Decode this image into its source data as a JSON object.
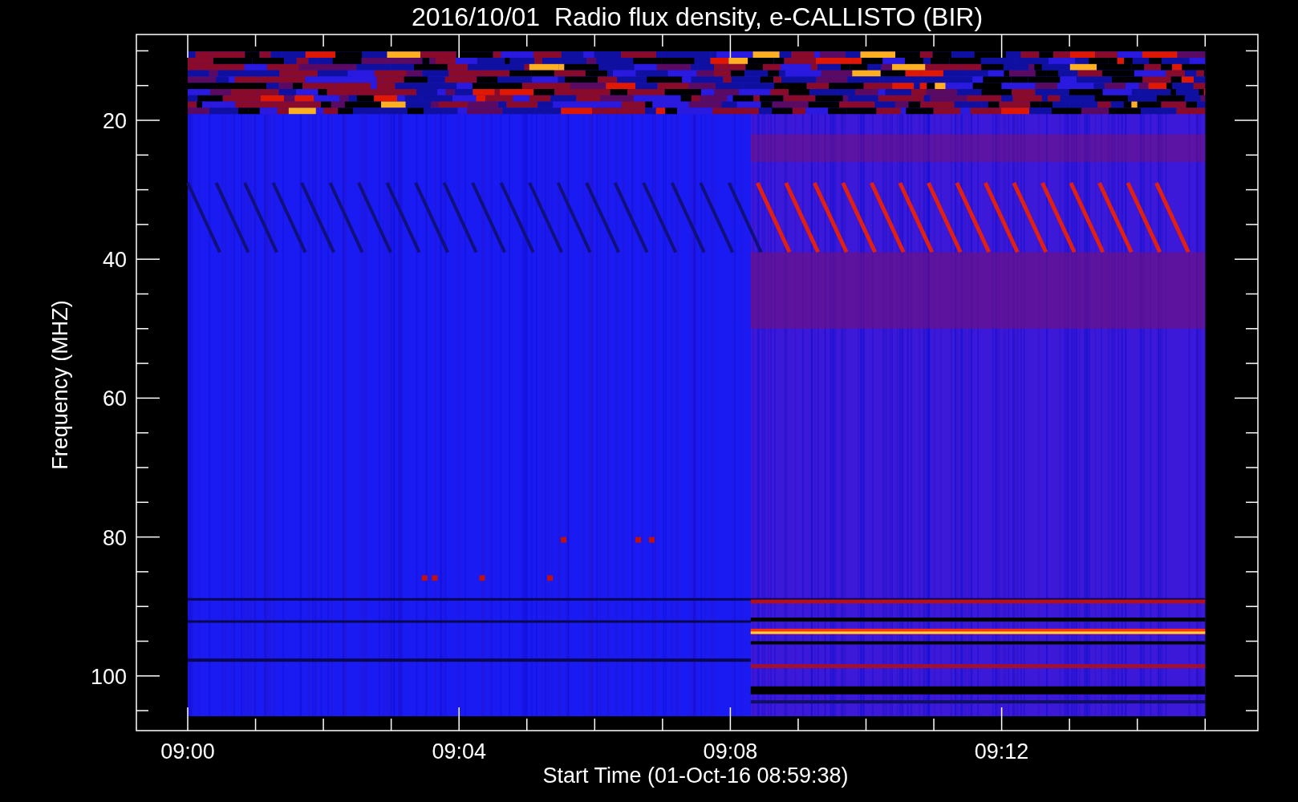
{
  "title": "2016/10/01  Radio flux density, e-CALLISTO (BIR)",
  "plot": {
    "ylabel": "Frequency (MHZ)",
    "xlabel": "Start Time (01-Oct-16 08:59:38)",
    "yticks": [
      "20",
      "40",
      "60",
      "80",
      "100"
    ],
    "xticks": [
      "09:00",
      "09:04",
      "09:08",
      "09:12"
    ]
  }
}
